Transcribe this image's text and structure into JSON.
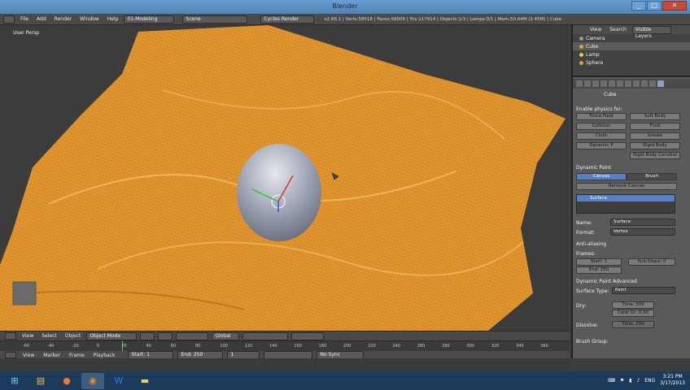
{
  "window": {
    "title": "Blender"
  },
  "menu": {
    "file": "File",
    "add": "Add",
    "render": "Render",
    "window": "Window",
    "help": "Help"
  },
  "layout": {
    "screen": "01-Modeling",
    "scene": "Scene",
    "engine": "Cycles Render"
  },
  "stats": "v2.66.1 | Verts:58518 | Faces:58009 | Tris:117914 | Objects:1/3 | Lamps:0/1 | Mem:50.64M (2.45M) | Cube",
  "viewport": {
    "label": "User Persp"
  },
  "viewport_header": {
    "view": "View",
    "select": "Select",
    "object": "Object",
    "mode": "Object Mode",
    "orientation": "Global"
  },
  "timeline": {
    "ticks": [
      "-60",
      "-40",
      "-20",
      "0",
      "20",
      "40",
      "60",
      "80",
      "100",
      "120",
      "140",
      "160",
      "180",
      "200",
      "220",
      "240",
      "260",
      "280",
      "300",
      "320",
      "340",
      "360"
    ],
    "view": "View",
    "marker": "Marker",
    "frame": "Frame",
    "playback": "Playback",
    "start": "Start: 1",
    "end": "End: 250",
    "current": "1",
    "sync": "No Sync"
  },
  "outliner": {
    "view": "View",
    "search": "Search",
    "filter": "Visible Layers",
    "items": [
      "Camera",
      "Cube",
      "Lamp",
      "Sphere"
    ]
  },
  "properties": {
    "object": "Cube",
    "enable_physics": "Enable physics for:",
    "buttons": [
      "Force Field",
      "Soft Body",
      "Collision",
      "Fluid",
      "Cloth",
      "Smoke",
      "Dynamic P",
      "Rigid Body",
      "Rigid Body Constrai"
    ],
    "dynamic_paint": "Dynamic Paint",
    "canvas": "Canvas",
    "brush": "Brush",
    "remove_canvas": "Remove Canvas",
    "surface_item": "Surface",
    "name_label": "Name:",
    "name_value": "Surface",
    "format_label": "Format:",
    "format_value": "Vertex",
    "anti_aliasing": "Anti-aliasing",
    "frames": "Frames:",
    "start": "Start: 1",
    "end": "End: 250",
    "substeps": "Sub-Steps: 0",
    "advanced": "Dynamic Paint Advanced",
    "surface_type_label": "Surface Type:",
    "surface_type": "Paint",
    "dry": "Dry:",
    "time": "Time: 500",
    "color_dry": "Color Dr: 0.00",
    "dissolve": "Dissolve:",
    "dissolve_time": "Time: 250",
    "brush_group": "Brush Group:"
  },
  "taskbar": {
    "lang": "ENG",
    "time": "3:21 PM",
    "date": "3/17/2013"
  },
  "colors": {
    "wireframe": "#e8a33a",
    "sphere": "#9aa0b0",
    "accent": "#5680c2"
  }
}
